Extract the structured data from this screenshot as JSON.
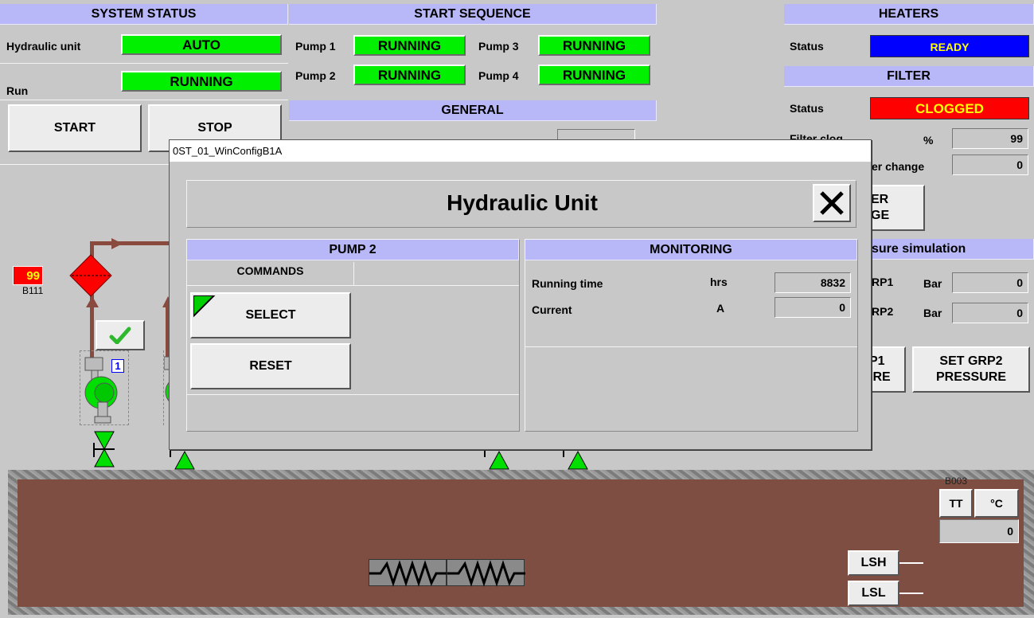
{
  "system_status": {
    "title": "SYSTEM STATUS",
    "hydraulic_unit_label": "Hydraulic unit",
    "hydraulic_unit_value": "AUTO",
    "run_label": "Run",
    "run_value": "RUNNING",
    "start_label": "START",
    "stop_label": "STOP"
  },
  "start_sequence": {
    "title": "START SEQUENCE",
    "pumps": [
      {
        "label": "Pump 1",
        "value": "RUNNING"
      },
      {
        "label": "Pump 2",
        "value": "RUNNING"
      },
      {
        "label": "Pump 3",
        "value": "RUNNING"
      },
      {
        "label": "Pump 4",
        "value": "RUNNING"
      }
    ]
  },
  "general": {
    "title": "GENERAL"
  },
  "heaters": {
    "title": "HEATERS",
    "status_label": "Status",
    "status_value": "READY"
  },
  "filter": {
    "title": "FILTER",
    "status_label": "Status",
    "status_value": "CLOGGED",
    "clog_label": "Filter clog",
    "clog_unit": "%",
    "clog_value": "99",
    "change_label": "er change",
    "change_value": "0",
    "change_button": "ER\nGE"
  },
  "pressure_sim": {
    "title": "sure simulation",
    "grp1_label": "RP1",
    "grp1_unit": "Bar",
    "grp1_value": "0",
    "grp2_label": "RP2",
    "grp2_unit": "Bar",
    "grp2_value": "0",
    "set_grp1_line1": "P1",
    "set_grp1_line2": "IRE",
    "set_grp2_line1": "SET GRP2",
    "set_grp2_line2": "PRESSURE"
  },
  "process": {
    "filter_tag_value": "99",
    "filter_tag_id": "B111",
    "pump1_number": "1",
    "tank_tag": "B003",
    "tt_label": "TT",
    "tt_unit": "°C",
    "tt_value": "0",
    "lsh_label": "LSH",
    "lsl_label": "LSL"
  },
  "dialog": {
    "window_title": "0ST_01_WinConfigB1A",
    "title": "Hydraulic Unit",
    "pump_panel_title": "PUMP 2",
    "commands_label": "COMMANDS",
    "select_label": "SELECT",
    "reset_label": "RESET",
    "monitoring_title": "MONITORING",
    "running_time_label": "Running time",
    "running_time_unit": "hrs",
    "running_time_value": "8832",
    "current_label": "Current",
    "current_unit": "A",
    "current_value": "0"
  },
  "colors": {
    "header": "#b8b8f8",
    "green": "#00f000",
    "blue": "#0000ff",
    "red": "#ff0000",
    "pipe": "#8b4a3e",
    "tank": "#7e4e42"
  }
}
